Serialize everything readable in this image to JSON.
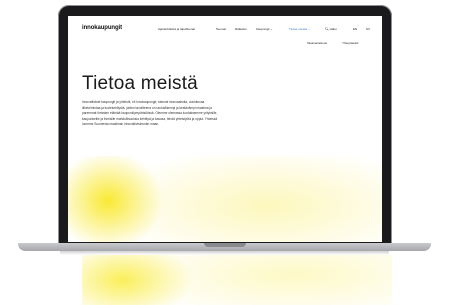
{
  "site": {
    "logo": "innokaupungit"
  },
  "nav": {
    "items": [
      {
        "label": "Ajankohtaista ja tapahtumat"
      },
      {
        "label": "Teemat"
      },
      {
        "label": "Ratkaisu"
      },
      {
        "label": "Kaupungit ⌄"
      },
      {
        "label": "Tietoa meistä ⌄"
      }
    ],
    "search_label": "Haku",
    "lang": [
      "EN",
      "SV"
    ]
  },
  "subnav": [
    "Tasavertaisuus",
    "Yhteystiedot"
  ],
  "page": {
    "title": "Tietoa meistä",
    "paragraph_lines": [
      "Innovatiiviset kaupungit ja yhteisöt, eli Innokaupungit, tukevat innovaatioita, uusiutuvaa",
      "liiketoimintaa ja tuotekehitystä, joiden tavoitteena on rauhallisempi ja kestävämpi maailma ja",
      "paremmat ihmisten elämää kaupunkiympäristöissä. Olemme olemassa luodaksemme yrityksille,",
      "kaupunkeille ja ihmisille mahdollisuuksia kehittyä ja kasvaa, tehdä yhteistyötä ja oppia. Yhdessä",
      "luomme Suomesta maailman innovatiivisimmän maan."
    ]
  },
  "colors": {
    "accent": "#3a7bd5",
    "glow": "#f9e828",
    "laptop": "#1a1a1c"
  }
}
